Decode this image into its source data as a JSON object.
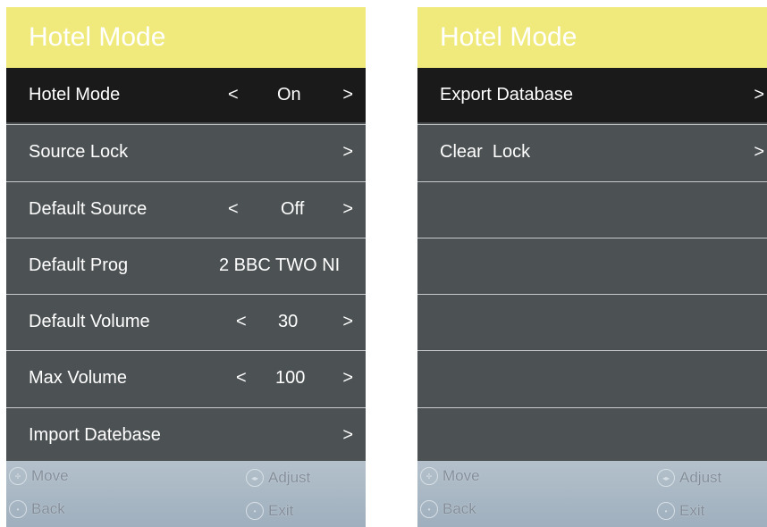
{
  "left": {
    "title": "Hotel Mode",
    "items": [
      {
        "label": "Hotel Mode",
        "lt": "<",
        "value": "On",
        "gt": ">"
      },
      {
        "label": "Source Lock",
        "gt": ">"
      },
      {
        "label": "Default Source",
        "lt": "<",
        "value": "Off",
        "gt": ">"
      },
      {
        "label": "Default Prog",
        "value": "2 BBC TWO NI"
      },
      {
        "label": "Default Volume",
        "lt": "<",
        "value": "30",
        "gt": ">"
      },
      {
        "label": "Max Volume",
        "lt": "<",
        "value": "100",
        "gt": ">"
      },
      {
        "label": "Import Datebase",
        "gt": ">"
      }
    ],
    "footer": {
      "move": "Move",
      "adjust": "Adjust",
      "back": "Back",
      "exit": "Exit"
    }
  },
  "right": {
    "title": "Hotel Mode",
    "items": [
      {
        "label": "Export Database",
        "gt": ">"
      },
      {
        "label": "Clear  Lock",
        "gt": ">"
      }
    ],
    "footer": {
      "move": "Move",
      "adjust": "Adjust",
      "back": "Back",
      "exit": "Exit"
    }
  },
  "colors": {
    "title_bar": "#f0ea7c",
    "selected_row": "#1a1a1a",
    "row": "#4c5153",
    "footer": "#a9b7c4"
  },
  "icons": {
    "move": "dpad-icon",
    "adjust": "left-right-icon",
    "back": "back-button-icon",
    "exit": "exit-button-icon"
  }
}
